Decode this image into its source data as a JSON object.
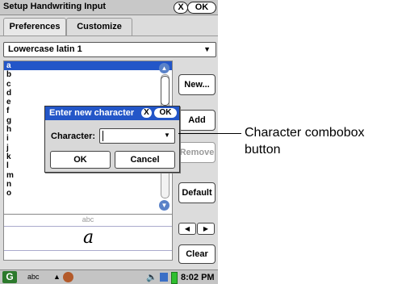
{
  "window": {
    "title": "Setup Handwriting Input",
    "close_label": "X",
    "ok_label": "OK"
  },
  "tabs": [
    {
      "label": "Preferences"
    },
    {
      "label": "Customize"
    }
  ],
  "charset_dropdown": {
    "value": "Lowercase latin 1"
  },
  "char_list": [
    "a",
    "b",
    "c",
    "d",
    "e",
    "f",
    "g",
    "h",
    "i",
    "j",
    "k",
    "l",
    "m",
    "n",
    "o"
  ],
  "side_buttons": {
    "new": "New...",
    "add": "Add",
    "remove": "Remove",
    "default": "Default"
  },
  "input_area": {
    "hint": "abc",
    "glyph": "a"
  },
  "nav_arrows": {
    "left": "◀",
    "right": "▶"
  },
  "clear_label": "Clear",
  "dialog": {
    "title": "Enter new character",
    "close_label": "X",
    "ok_label": "OK",
    "character_label": "Character:",
    "character_value": "",
    "ok_button": "OK",
    "cancel_button": "Cancel"
  },
  "taskbar": {
    "start_glyph": "G",
    "input_label": "abc",
    "time": "8:02 PM"
  },
  "callout": {
    "text": "Character combobox button"
  },
  "icons": {
    "close": "close-icon",
    "dropdown": "chevron-down-icon",
    "scroll_up": "chevron-up-icon",
    "scroll_down": "chevron-down-icon",
    "speaker": "speaker-icon",
    "network": "network-icon",
    "battery": "battery-icon"
  }
}
